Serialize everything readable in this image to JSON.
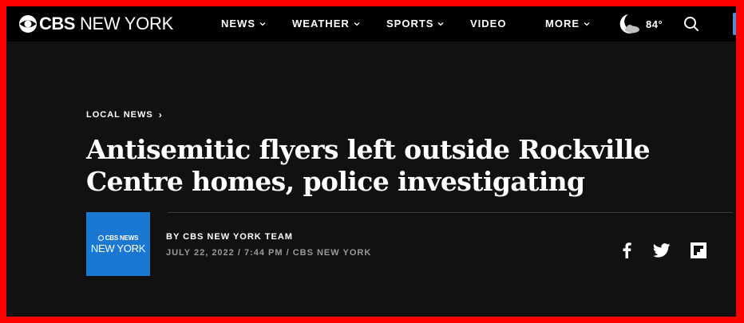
{
  "header": {
    "logo_brand": "CBS",
    "logo_station": "NEW YORK",
    "nav": [
      {
        "label": "NEWS",
        "has_dropdown": true
      },
      {
        "label": "WEATHER",
        "has_dropdown": true
      },
      {
        "label": "SPORTS",
        "has_dropdown": true
      },
      {
        "label": "VIDEO",
        "has_dropdown": false
      },
      {
        "label": "MORE",
        "has_dropdown": true
      }
    ],
    "weather_temp": "84°",
    "weather_icon": "moon-cloud-icon",
    "search_icon": "search-icon"
  },
  "article": {
    "breadcrumb": "LOCAL NEWS",
    "breadcrumb_sep": "›",
    "headline": "Antisemitic flyers left outside Rockville Centre homes, police investigating",
    "avatar_line1": "CBS NEWS",
    "avatar_line2": "NEW YORK",
    "byline": "BY CBS NEW YORK TEAM",
    "dateline": "JULY 22, 2022 / 7:44 PM / CBS NEW YORK",
    "share": [
      "facebook-icon",
      "twitter-icon",
      "flipboard-icon"
    ]
  },
  "colors": {
    "frame_border": "#ff0000",
    "background": "#111111",
    "header_bg": "#000000",
    "avatar_bg": "#1a78d2",
    "dateline": "#9a9a9a"
  }
}
